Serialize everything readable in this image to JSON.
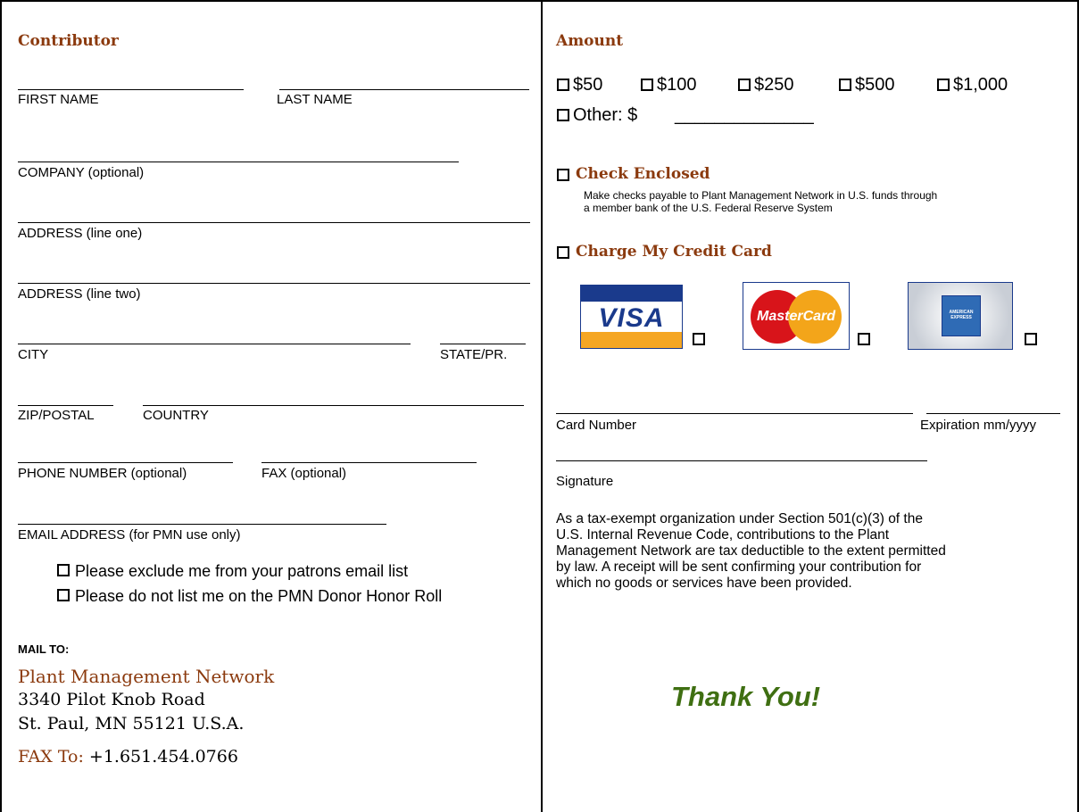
{
  "contributor": {
    "heading": "Contributor",
    "first_name": "FIRST NAME",
    "last_name": "LAST NAME",
    "company": "COMPANY (optional)",
    "address1": "ADDRESS (line one)",
    "address2": "ADDRESS (line two)",
    "city": "CITY",
    "state": "STATE/PR.",
    "zip": "ZIP/POSTAL",
    "country": "COUNTRY",
    "phone": "PHONE NUMBER (optional)",
    "fax": "FAX (optional)",
    "email": "EMAIL ADDRESS (for PMN use only)",
    "exclude_email": "Please exclude me from your patrons email list",
    "no_honor_roll": "Please do not list me on the PMN Donor Honor Roll"
  },
  "mail": {
    "label": "MAIL TO:",
    "org": "Plant Management Network",
    "street": "3340 Pilot Knob Road",
    "city_line": "St. Paul, MN 55121 U.S.A.",
    "fax_label": "FAX To:",
    "fax_number": "+1.651.454.0766"
  },
  "amount": {
    "heading": "Amount",
    "options": [
      "$50",
      "$100",
      "$250",
      "$500",
      "$1,000"
    ],
    "other": "Other:  $",
    "other_blank": "______________"
  },
  "check": {
    "heading": "Check Enclosed",
    "note_line1": "Make checks payable to Plant Management Network in U.S. funds through",
    "note_line2": "a member bank of the U.S. Federal Reserve System"
  },
  "card": {
    "heading": "Charge My Credit Card",
    "visa_logo": "VISA",
    "mastercard_logo": "MasterCard",
    "amex_logo": "AMERICAN EXPRESS",
    "card_number": "Card Number",
    "expiration": "Expiration mm/yyyy",
    "signature": "Signature"
  },
  "tax": {
    "line1": "As a tax-exempt organization under Section 501(c)(3) of the",
    "line2": "U.S. Internal Revenue Code, contributions to the Plant",
    "line3": "Management Network are tax deductible to the extent permitted",
    "line4": "by law. A receipt will be sent confirming your contribution for",
    "line5": "which no goods or services have been provided."
  },
  "thanks": "Thank You!",
  "colors": {
    "accent": "#8b3a0e",
    "thanks": "#3f6f12",
    "visa_blue": "#1a3a8c",
    "visa_gold": "#f5a623"
  }
}
